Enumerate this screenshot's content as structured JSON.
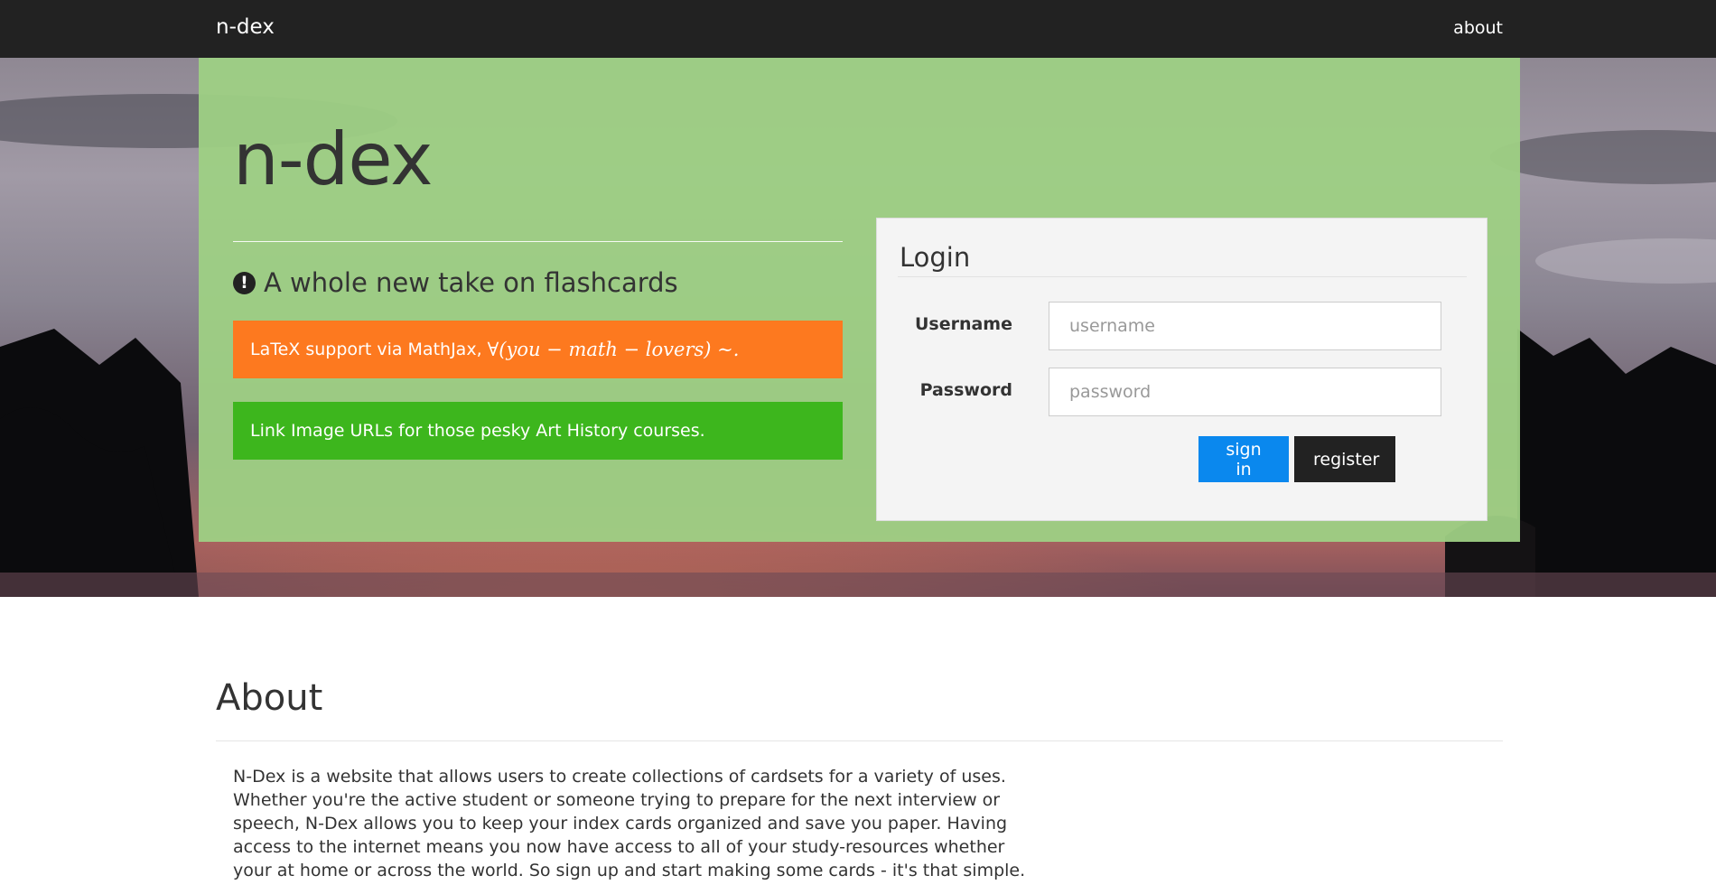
{
  "navbar": {
    "brand": "n-dex",
    "about_link": "about"
  },
  "hero": {
    "title": "n-dex",
    "tagline": "A whole new take on flashcards",
    "tagline_icon": "exclamation-circle-icon",
    "features": [
      {
        "text": "LaTeX support via MathJax,",
        "math": "∀(you − math − lovers) ∼.",
        "color": "#fd791f"
      },
      {
        "text": "Link Image URLs for those pesky Art History courses.",
        "color": "#3db61d"
      }
    ],
    "background_color": "#9ed084"
  },
  "login": {
    "title": "Login",
    "username_label": "Username",
    "username_placeholder": "username",
    "username_value": "",
    "password_label": "Password",
    "password_placeholder": "password",
    "password_value": "",
    "signin_label": "sign in",
    "register_label": "register",
    "signin_color": "#0a88ee",
    "register_color": "#222222"
  },
  "about": {
    "title": "About",
    "body": "N-Dex is a website that allows users to create collections of cardsets for a variety of uses. Whether you're the active student or someone trying to prepare for the next interview or speech, N-Dex allows you to keep your index cards organized and save you paper. Having access to the internet means you now have access to all of your study-resources whether your at home or across the world. So sign up and start making some cards - it's that simple."
  }
}
